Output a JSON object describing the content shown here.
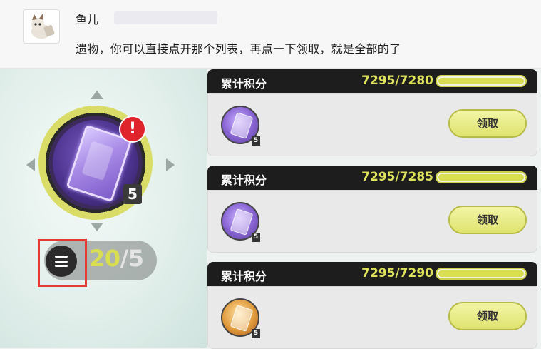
{
  "chat": {
    "username": "鱼儿",
    "message": "遗物，你可以直接点开那个列表，再点一下领取，就是全部的了"
  },
  "left_panel": {
    "item_count": "5",
    "alert_glyph": "!",
    "progress_current": "20",
    "progress_total": "/5",
    "menu_icon": "menu-icon"
  },
  "rewards": [
    {
      "title": "累计积分",
      "score": "7295/7280",
      "fill": 1.0,
      "item_color": "purple",
      "item_count": "5",
      "button": "领取"
    },
    {
      "title": "累计积分",
      "score": "7295/7285",
      "fill": 1.0,
      "item_color": "purple",
      "item_count": "5",
      "button": "领取"
    },
    {
      "title": "累计积分",
      "score": "7295/7290",
      "fill": 1.0,
      "item_color": "gold",
      "item_count": "5",
      "button": "领取"
    }
  ],
  "colors": {
    "accent": "#d8dd52",
    "alert": "#e0242c",
    "highlight_box": "#e53935"
  }
}
